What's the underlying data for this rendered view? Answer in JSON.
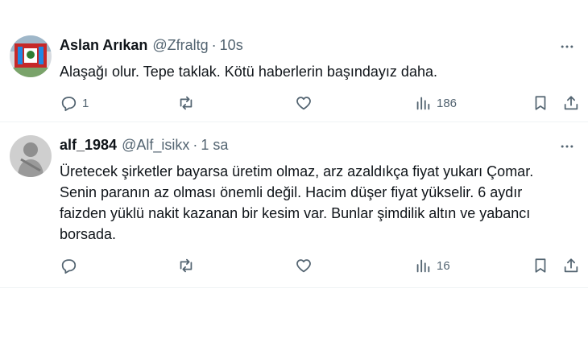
{
  "tweets": [
    {
      "name": "Aslan Arıkan",
      "handle": "@Zfraltg",
      "separator": "·",
      "time": "10s",
      "text": "Alaşağı olur. Tepe taklak. Kötü haberlerin başındayız daha.",
      "replies": "1",
      "reposts": "",
      "likes": "",
      "views": "186"
    },
    {
      "name": "alf_1984",
      "handle": "@Alf_isikx",
      "separator": "·",
      "time": "1 sa",
      "text": "Üretecek şirketler bayarsa üretim olmaz, arz azaldıkça fiyat yukarı Çomar.\nSenin paranın az olması önemli değil. Hacim düşer fiyat yükselir. 6 aydır\nfaizden yüklü nakit kazanan bir kesim var. Bunlar şimdilik altın ve yabancı\nborsada.",
      "replies": "",
      "reposts": "",
      "likes": "",
      "views": "16"
    }
  ],
  "icons": {
    "reply": "reply-icon",
    "repost": "repost-icon",
    "like": "heart-icon",
    "views": "views-chart-icon",
    "bookmark": "bookmark-icon",
    "share": "share-icon",
    "more": "more-dots-icon"
  },
  "colors": {
    "text_primary": "#0f1419",
    "text_secondary": "#536471",
    "divider": "#eff3f4"
  }
}
